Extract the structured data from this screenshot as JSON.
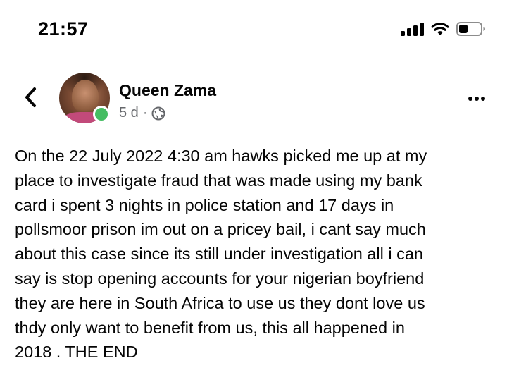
{
  "status_bar": {
    "time": "21:57",
    "icons": [
      "signal-icon",
      "wifi-icon",
      "battery-icon"
    ]
  },
  "header": {
    "back_icon": "chevron-left-icon",
    "author_name": "Queen Zama",
    "post_age": "5 d",
    "separator": "·",
    "audience_icon": "globe-icon",
    "more_icon": "more-horizontal-icon",
    "online_indicator_color": "#45bd62"
  },
  "post": {
    "text": "On the 22 July 2022 4:30 am hawks picked me up at my\nplace to investigate fraud that was made using my bank\ncard i spent 3 nights in police station and 17 days in\npollsmoor prison im out on a pricey bail, i cant say much\nabout this case since its still under investigation all i can\nsay is stop opening accounts for your nigerian boyfriend\nthey are here in South Africa to use us they dont love us\nthdy only want to benefit from us, this all happened in\n2018 . THE END"
  },
  "colors": {
    "text_primary": "#050505",
    "text_secondary": "#65676b",
    "background": "#ffffff"
  }
}
